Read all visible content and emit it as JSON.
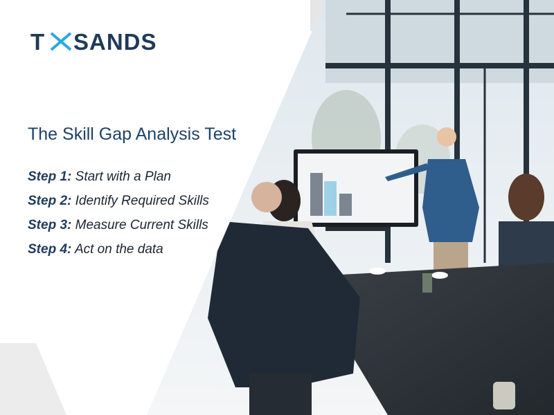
{
  "brand": {
    "name_left": "T",
    "name_right": "SANDS",
    "mark_color": "#29a9e1",
    "text_color": "#1f3a5a"
  },
  "content": {
    "title": "The Skill Gap Analysis Test",
    "steps": [
      {
        "number": "Step 1:",
        "text": "Start with a Plan"
      },
      {
        "number": "Step 2:",
        "text": "Identify Required Skills"
      },
      {
        "number": "Step 3:",
        "text": "Measure Current Skills"
      },
      {
        "number": "Step 4:",
        "text": "Act on the data"
      }
    ]
  },
  "photo": {
    "description_icon": "business-meeting-photo"
  },
  "colors": {
    "title": "#1d4268",
    "step_number": "#1e3a5f",
    "accent_gray": "#ececec"
  }
}
